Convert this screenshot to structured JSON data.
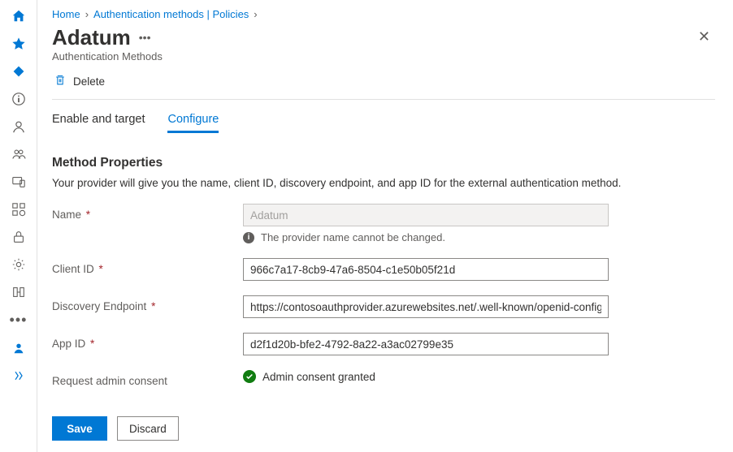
{
  "breadcrumb": {
    "home": "Home",
    "policies": "Authentication methods | Policies"
  },
  "header": {
    "title": "Adatum",
    "subtitle": "Authentication Methods"
  },
  "toolbar": {
    "delete": "Delete"
  },
  "tabs": {
    "enable": "Enable and target",
    "configure": "Configure"
  },
  "section": {
    "title": "Method Properties",
    "desc": "Your provider will give you the name, client ID, discovery endpoint, and app ID for the external authentication method."
  },
  "form": {
    "name_label": "Name",
    "name_value": "Adatum",
    "name_hint": "The provider name cannot be changed.",
    "client_label": "Client ID",
    "client_value": "966c7a17-8cb9-47a6-8504-c1e50b05f21d",
    "discovery_label": "Discovery Endpoint",
    "discovery_value": "https://contosoauthprovider.azurewebsites.net/.well-known/openid-configurati...",
    "appid_label": "App ID",
    "appid_value": "d2f1d20b-bfe2-4792-8a22-a3ac02799e35",
    "consent_label": "Request admin consent",
    "consent_status": "Admin consent granted"
  },
  "footer": {
    "save": "Save",
    "discard": "Discard"
  }
}
